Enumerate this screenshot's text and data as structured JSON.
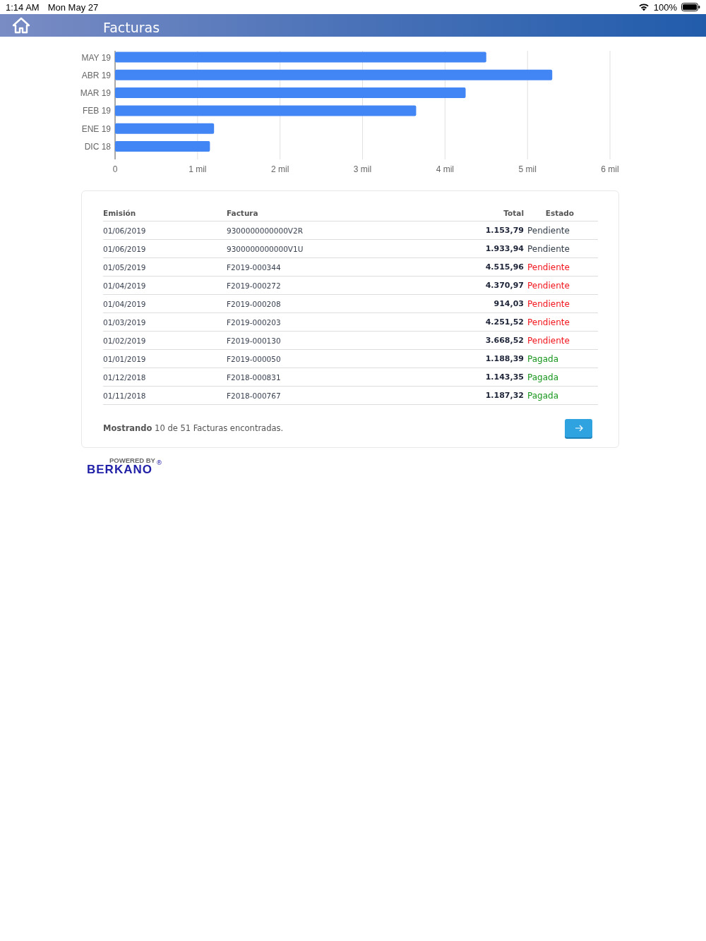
{
  "status_bar": {
    "time": "1:14 AM",
    "date": "Mon May 27",
    "battery": "100%"
  },
  "header": {
    "title": "Facturas"
  },
  "chart_data": {
    "type": "bar",
    "orientation": "horizontal",
    "categories": [
      "MAY 19",
      "ABR 19",
      "MAR 19",
      "FEB 19",
      "ENE 19",
      "DIC 18"
    ],
    "series": [
      {
        "color": "#4285f4",
        "values": [
          4.5,
          5.3,
          4.25,
          3.65,
          1.2,
          1.15
        ]
      }
    ],
    "grid": true,
    "xlim": [
      0,
      6
    ],
    "xticks": [
      {
        "value": 0,
        "label": "0"
      },
      {
        "value": 1,
        "label": "1 mil"
      },
      {
        "value": 2,
        "label": "2 mil"
      },
      {
        "value": 3,
        "label": "3 mil"
      },
      {
        "value": 4,
        "label": "4 mil"
      },
      {
        "value": 5,
        "label": "5 mil"
      },
      {
        "value": 6,
        "label": "6 mil"
      }
    ]
  },
  "table": {
    "columns": [
      "Emisión",
      "Factura",
      "Total",
      "Estado"
    ],
    "rows": [
      {
        "emision": "01/06/2019",
        "factura": "9300000000000V2R",
        "total": "1.153,79",
        "estado": "Pendiente",
        "color": "#333d4a"
      },
      {
        "emision": "01/06/2019",
        "factura": "9300000000000V1U",
        "total": "1.933,94",
        "estado": "Pendiente",
        "color": "#333d4a"
      },
      {
        "emision": "01/05/2019",
        "factura": "F2019-000344",
        "total": "4.515,96",
        "estado": "Pendiente",
        "color": "#f2141c"
      },
      {
        "emision": "01/04/2019",
        "factura": "F2019-000272",
        "total": "4.370,97",
        "estado": "Pendiente",
        "color": "#f2141c"
      },
      {
        "emision": "01/04/2019",
        "factura": "F2019-000208",
        "total": "914,03",
        "estado": "Pendiente",
        "color": "#f2141c"
      },
      {
        "emision": "01/03/2019",
        "factura": "F2019-000203",
        "total": "4.251,52",
        "estado": "Pendiente",
        "color": "#f2141c"
      },
      {
        "emision": "01/02/2019",
        "factura": "F2019-000130",
        "total": "3.668,52",
        "estado": "Pendiente",
        "color": "#f2141c"
      },
      {
        "emision": "01/01/2019",
        "factura": "F2019-000050",
        "total": "1.188,39",
        "estado": "Pagada",
        "color": "#19961e"
      },
      {
        "emision": "01/12/2018",
        "factura": "F2018-000831",
        "total": "1.143,35",
        "estado": "Pagada",
        "color": "#19961e"
      },
      {
        "emision": "01/11/2018",
        "factura": "F2018-000767",
        "total": "1.187,32",
        "estado": "Pagada",
        "color": "#19961e"
      }
    ],
    "summary": "**Mostrando** 10 de 51 Facturas encontradas."
  },
  "footer": {
    "powered_by": "POWERED BY",
    "logo": "BERKANO",
    "mark": "®"
  }
}
